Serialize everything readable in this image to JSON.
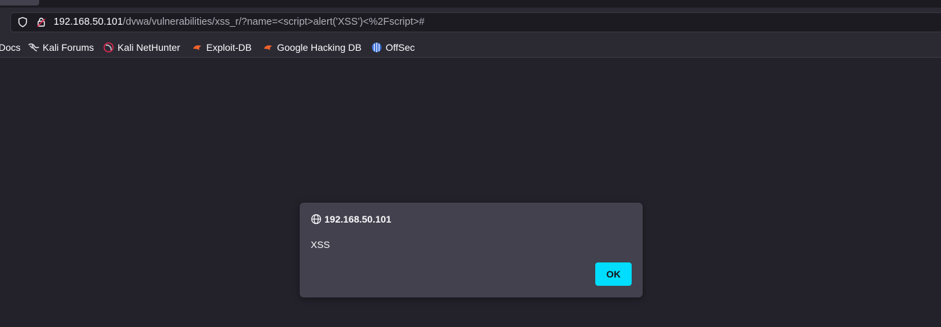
{
  "addressbar": {
    "url_host": "192.168.50.101",
    "url_path": "/dvwa/vulnerabilities/xss_r/?name=<script>alert('XSS')<%2Fscript>#"
  },
  "bookmarks": {
    "items": [
      {
        "label": "Docs",
        "icon": "none"
      },
      {
        "label": "Kali Forums",
        "icon": "kali-dragon-icon"
      },
      {
        "label": "Kali NetHunter",
        "icon": "nethunter-icon"
      },
      {
        "label": "Exploit-DB",
        "icon": "exploit-db-icon"
      },
      {
        "label": "Google Hacking DB",
        "icon": "exploit-db-icon"
      },
      {
        "label": "OffSec",
        "icon": "offsec-icon"
      }
    ]
  },
  "dialog": {
    "origin": "192.168.50.101",
    "message": "XSS",
    "ok_label": "OK"
  },
  "colors": {
    "accent": "#00ddff",
    "page_bg": "#23222b",
    "toolbar_bg": "#2b2a33",
    "dialog_bg": "#42414d"
  }
}
